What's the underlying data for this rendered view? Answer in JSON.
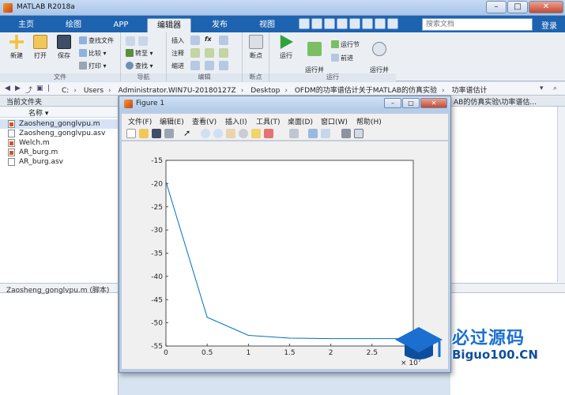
{
  "window": {
    "title": "MATLAB R2018a"
  },
  "tabs": [
    "主页",
    "绘图",
    "APP",
    "编辑器",
    "发布",
    "视图"
  ],
  "search": {
    "placeholder": "搜索文档"
  },
  "login": "登录",
  "ribbon": {
    "file": {
      "new": "新建",
      "open": "打开",
      "save": "保存",
      "find_files": "查找文件",
      "compare": "比较",
      "print": "打印",
      "label": "文件"
    },
    "navigate": {
      "goto": "转至",
      "find": "查找",
      "label": "导航"
    },
    "edit": {
      "insert": "插入",
      "comment": "注释",
      "indent": "缩进",
      "fx": "fx",
      "label": "编辑"
    },
    "breakpoints": {
      "bp": "断点",
      "label": "断点"
    },
    "run": {
      "run": "运行",
      "run_advance": "运行并\n前进",
      "run_section": "运行节",
      "advance": "前进",
      "run_time": "运行并\n计时",
      "label": "运行"
    }
  },
  "address": {
    "crumbs": [
      "C:",
      "Users",
      "Administrator.WIN7U-20180127Z",
      "Desktop",
      "OFDM的功率谱估计关于MATLAB的仿真实验",
      "功率谱估计"
    ]
  },
  "left_panel": {
    "title": "当前文件夹",
    "col_header": "名称",
    "files": [
      {
        "name": "Zaosheng_gonglvpu.m",
        "type": "m",
        "selected": true
      },
      {
        "name": "Zaosheng_gonglvpu.asv",
        "type": "asv",
        "selected": false
      },
      {
        "name": "Welch.m",
        "type": "m",
        "selected": false
      },
      {
        "name": "AR_burg.m",
        "type": "m",
        "selected": false
      },
      {
        "name": "AR_burg.asv",
        "type": "asv",
        "selected": false
      }
    ],
    "details": "Zaosheng_gonglvpu.m  (脚本)"
  },
  "right_panel": {
    "title": "AB的仿真实验\\功率谱估..."
  },
  "figure": {
    "title": "Figure 1",
    "menu": [
      "文件(F)",
      "编辑(E)",
      "查看(V)",
      "插入(I)",
      "工具(T)",
      "桌面(D)",
      "窗口(W)",
      "帮助(H)"
    ]
  },
  "chart_data": {
    "type": "line",
    "x": [
      0,
      5000000,
      10000000,
      15000000,
      20000000,
      25000000,
      30000000
    ],
    "y": [
      -19.6,
      -48.8,
      -52.7,
      -53.3,
      -53.4,
      -53.4,
      -53.4
    ],
    "xlim": [
      0,
      30000000
    ],
    "ylim": [
      -55,
      -15
    ],
    "xticks": [
      "0",
      "0.5",
      "1",
      "1.5",
      "2",
      "2.5",
      "3"
    ],
    "yticks": [
      "-15",
      "-20",
      "-25",
      "-30",
      "-35",
      "-40",
      "-45",
      "-50",
      "-55"
    ],
    "x_exponent": "× 10",
    "x_exponent_power": "7",
    "grid": false,
    "line_color": "#0072bd"
  },
  "watermark": {
    "cn": "必过源码",
    "en": "Biguo100.CN"
  }
}
